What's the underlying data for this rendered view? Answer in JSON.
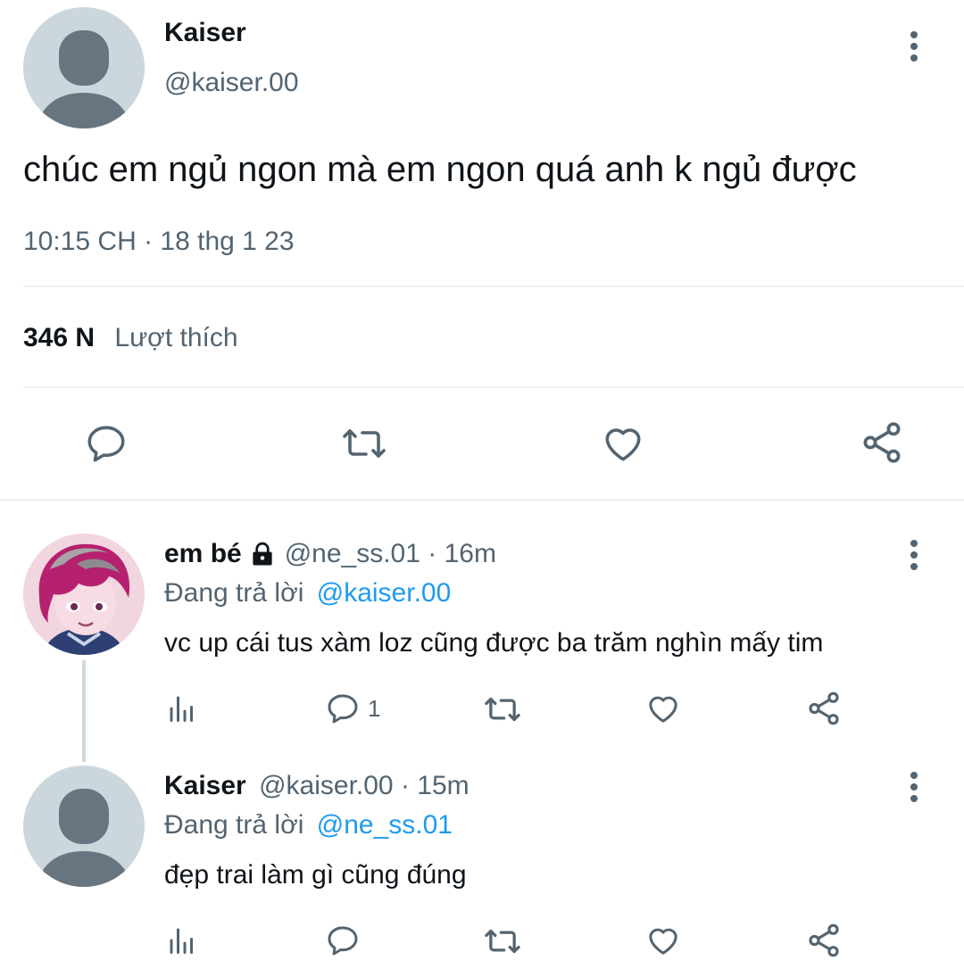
{
  "main_tweet": {
    "display_name": "Kaiser",
    "handle": "@kaiser.00",
    "text": "chúc em ngủ ngon mà em ngon quá anh k ngủ được",
    "timestamp": "10:15 CH · 18 thg 1 23",
    "like_count": "346 N",
    "like_label": "Lượt thích"
  },
  "replies": [
    {
      "display_name": "em bé",
      "handle_time": "@ne_ss.01 · 16m",
      "replying_prefix": "Đang trả lời",
      "replying_to": "@kaiser.00",
      "text": "vc up cái tus xàm loz cũng được ba trăm nghìn mấy tim",
      "reply_count": "1",
      "locked": true
    },
    {
      "display_name": "Kaiser",
      "handle_time": "@kaiser.00 · 15m",
      "replying_prefix": "Đang trả lời",
      "replying_to": "@ne_ss.01",
      "text": "đẹp trai làm gì cũng đúng",
      "reply_count": ""
    }
  ],
  "icons": {
    "more": "more-vertical-icon",
    "reply": "comment-bubble-icon",
    "retweet": "retweet-icon",
    "like": "heart-icon",
    "share": "share-icon",
    "analytics": "bar-chart-icon",
    "lock": "lock-icon"
  },
  "colors": {
    "text": "#0f1419",
    "muted": "#536471",
    "link": "#1d9bf0",
    "avatar_bg": "#ccd6dd",
    "avatar_fg": "#66757f",
    "divider": "#eff3f4"
  }
}
